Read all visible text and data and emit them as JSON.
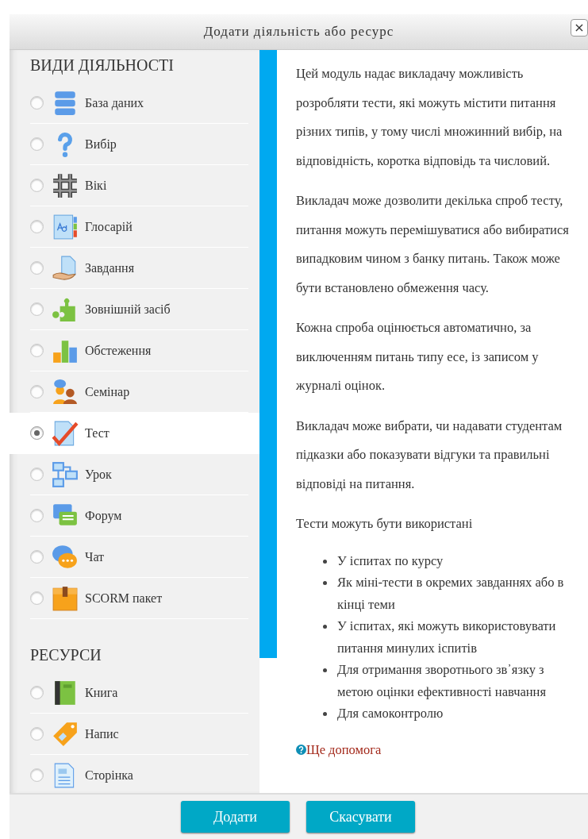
{
  "dialog": {
    "title": "Додати діяльність або ресурс",
    "close": "×"
  },
  "sections": [
    {
      "heading": "ВИДИ ДІЯЛЬНОСТІ",
      "items": [
        {
          "label": "База даних",
          "selected": false
        },
        {
          "label": "Вибір",
          "selected": false
        },
        {
          "label": "Вікі",
          "selected": false
        },
        {
          "label": "Глосарій",
          "selected": false
        },
        {
          "label": "Завдання",
          "selected": false
        },
        {
          "label": "Зовнішній засіб",
          "selected": false
        },
        {
          "label": "Обстеження",
          "selected": false
        },
        {
          "label": "Семінар",
          "selected": false
        },
        {
          "label": "Тест",
          "selected": true
        },
        {
          "label": "Урок",
          "selected": false
        },
        {
          "label": "Форум",
          "selected": false
        },
        {
          "label": "Чат",
          "selected": false
        },
        {
          "label": "SCORM пакет",
          "selected": false
        }
      ]
    },
    {
      "heading": "РЕСУРСИ",
      "items": [
        {
          "label": "Книга",
          "selected": false
        },
        {
          "label": "Напис",
          "selected": false
        },
        {
          "label": "Сторінка",
          "selected": false
        }
      ]
    }
  ],
  "description": {
    "paragraphs": [
      "Цей модуль надає викладачу можливість розробляти тести, які можуть містити питання різних типів, у тому числі множинний вибір, на відповідність, коротка відповідь та числовий.",
      "Викладач може дозволити декілька спроб тесту, питання можуть перемішуватися або вибиратися випадковим чином з банку питань. Також може бути встановлено обмеження часу.",
      "Кожна спроба оцінюється автоматично, за виключенням питань типу есе, із записом у журналі оцінок.",
      "Викладач може вибрати, чи надавати студентам підказки або показувати відгуки та правильні відповіді на питання.",
      "Тести можуть бути використані"
    ],
    "bullets": [
      "У іспитах по курсу",
      "Як міні-тести в окремих завданнях або в кінці теми",
      "У іспитах, які можуть використовувати питання минулих іспитів",
      "Для отримання зворотнього зв᾿язку з метою оцінки ефективності навчання",
      "Для самоконтролю"
    ],
    "help_link": "Ще допомога"
  },
  "buttons": [
    "Додати",
    "Скасувати"
  ]
}
